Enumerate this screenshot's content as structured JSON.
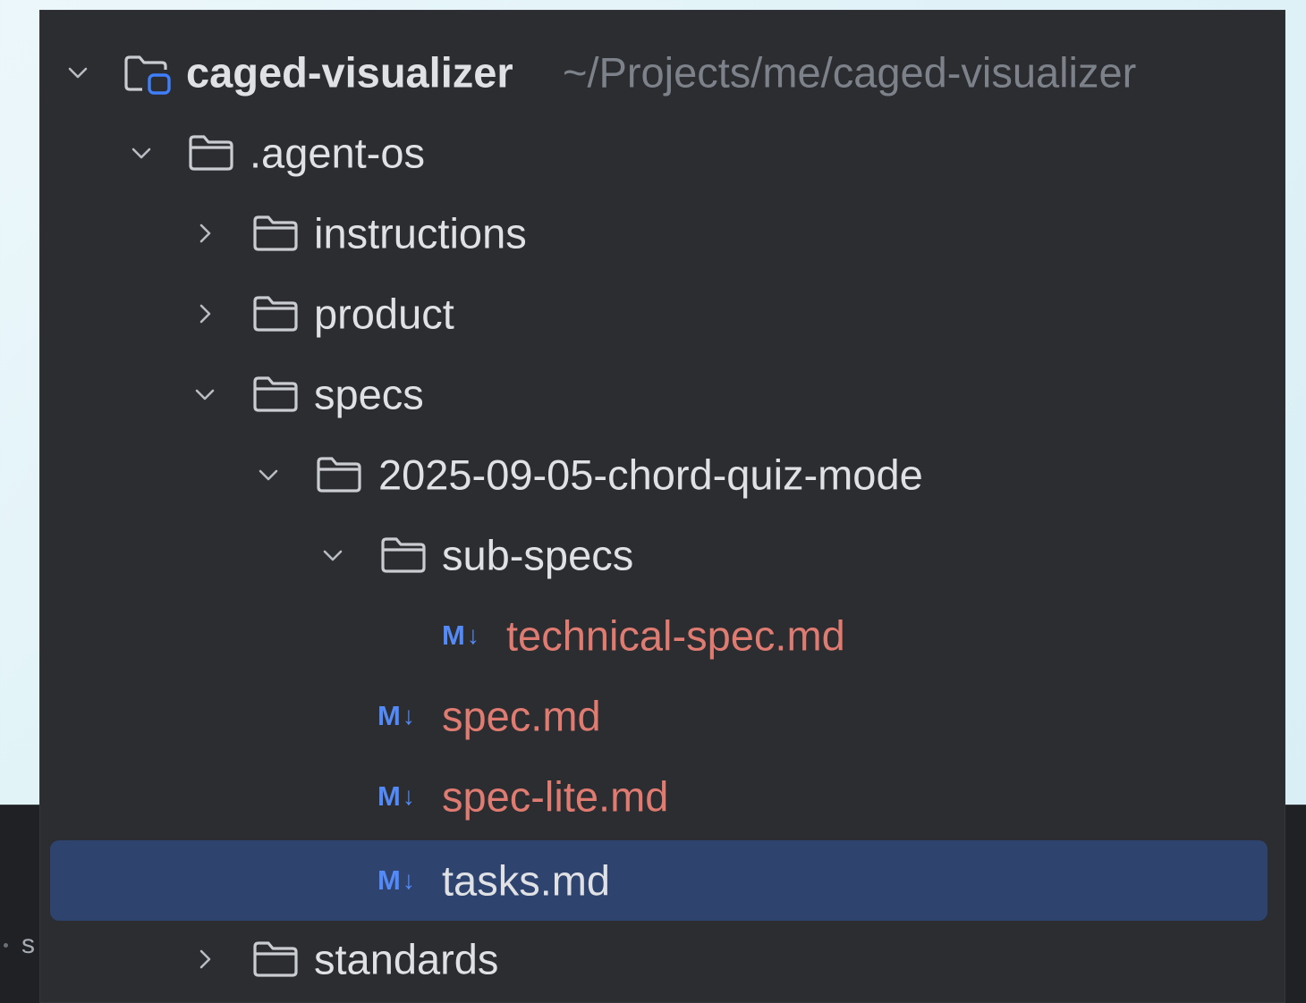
{
  "project_tree": {
    "root": {
      "name": "caged-visualizer",
      "path": "~/Projects/me/caged-visualizer"
    },
    "items": [
      {
        "label": ".agent-os",
        "type": "folder",
        "expanded": true
      },
      {
        "label": "instructions",
        "type": "folder",
        "expanded": false
      },
      {
        "label": "product",
        "type": "folder",
        "expanded": false
      },
      {
        "label": "specs",
        "type": "folder",
        "expanded": true
      },
      {
        "label": "2025-09-05-chord-quiz-mode",
        "type": "folder",
        "expanded": true
      },
      {
        "label": "sub-specs",
        "type": "folder",
        "expanded": true
      },
      {
        "label": "technical-spec.md",
        "type": "markdown",
        "status": "modified"
      },
      {
        "label": "spec.md",
        "type": "markdown",
        "status": "modified"
      },
      {
        "label": "spec-lite.md",
        "type": "markdown",
        "status": "modified"
      },
      {
        "label": "tasks.md",
        "type": "markdown",
        "status": "selected"
      },
      {
        "label": "standards",
        "type": "folder",
        "expanded": false
      }
    ],
    "markdown_icon_text": "M",
    "markdown_icon_arrow": "↓"
  },
  "background": {
    "partial_label": "s"
  },
  "colors": {
    "panel_bg": "#2b2d30",
    "selection_bg": "#2e436e",
    "text": "#dfe1e5",
    "modified_text": "#e07b72",
    "path_hint": "#7d828a",
    "markdown_icon": "#548af7",
    "module_badge": "#3f7ffc"
  }
}
